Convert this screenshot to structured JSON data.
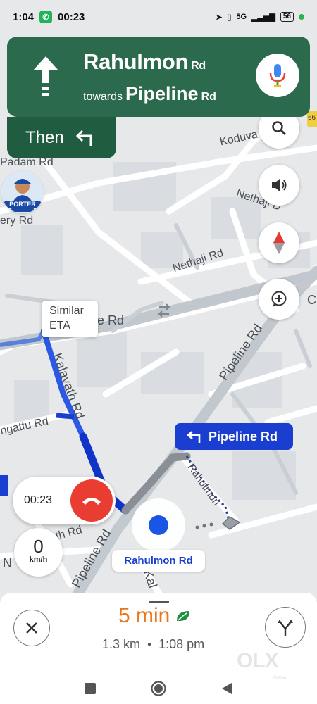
{
  "status_bar": {
    "time": "1:04",
    "call_time": "00:23",
    "network": "5G",
    "battery": "56"
  },
  "navigation": {
    "street": "Rahulmon",
    "street_suffix": "Rd",
    "towards_label": "towards",
    "towards_street": "Pipeline",
    "towards_suffix": "Rd",
    "then_label": "Then"
  },
  "map": {
    "labels": [
      "Padam Rd",
      "Koduva",
      "ery Rd",
      "Nethaji D",
      "Nethaji Rd",
      "e Rd",
      "Kalavath Rd",
      "ngattu Rd",
      "Pipeline Rd",
      "Rahulmon",
      "ath Rd",
      "Pipeline Rd",
      "Kal",
      "C",
      "N",
      "66"
    ],
    "similar_eta": [
      "Similar",
      "ETA"
    ],
    "turn_chip": "Pipeline Rd",
    "current_road": "Rahulmon Rd",
    "porter_label": "PORTER"
  },
  "call_widget": {
    "timer": "00:23"
  },
  "speed": {
    "value": "0",
    "unit": "km/h"
  },
  "trip": {
    "eta": "5 min",
    "distance": "1.3 km",
    "arrival": "1:08 pm"
  },
  "watermark": {
    "text": "OLX",
    "sub": "INDIA"
  },
  "colors": {
    "banner": "#2b6a4d",
    "then_box": "#1f5c40",
    "route": "#1a3fd0",
    "eta": "#e9761b",
    "hangup": "#ea3d32"
  }
}
